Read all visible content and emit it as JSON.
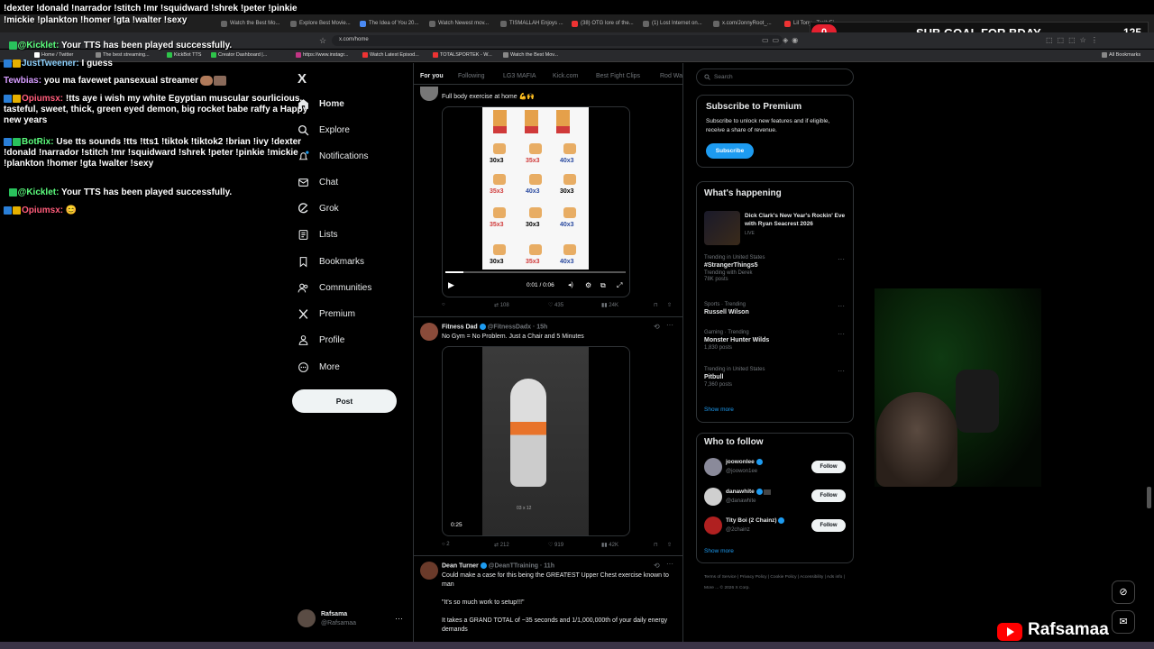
{
  "overlay": {
    "sub_goal_count": "0",
    "sub_goal_label": "SUB GOAL FOR BDAY",
    "sub_goal_target": "125",
    "channel": "Rafsamaa"
  },
  "browser": {
    "tabs": [
      "Home / Twitter",
      "Watch the Best Mo...",
      "Explore Best Movie...",
      "The Idea of You 20...",
      "Watch Newest mov...",
      "TISMALLAH Enjoys ...",
      "(38) OTG lore of the...",
      "(1) Lost Internet on...",
      "x.com/JonnyRoot_...",
      "Lil Tony - TrellyFi..."
    ],
    "url": "x.com/home",
    "bookmarks": [
      "Home / Twitter",
      "The best streaming...",
      "KickBot TTS",
      "Creator Dashboard |...",
      "https://www.instagr...",
      "Watch Latest Episod...",
      "TOTALSPORTEK - W...",
      "Watch the Best Mov..."
    ],
    "all_bookmarks": "All Bookmarks"
  },
  "chat": {
    "line0": "!dexter !donald !narrador !stitch !mr !squidward !shrek !peter !pinkie",
    "line0b": "!mickie !plankton !homer !gta !walter !sexy",
    "m1_user": "@Kicklet:",
    "m1_text": " Your TTS has been played successfully.",
    "m2_user": "JustTweener:",
    "m2_text": " I guess",
    "m3_user": "Tewbias:",
    "m3_text": " you ma favewet pansexual streamer",
    "m4_user": "Opiumsx:",
    "m4_text": " !tts aye i wish my white Egyptian muscular sourlicious, tasteful, sweet, thick, green eyed demon, big rocket babe raffy a Happy new years",
    "m5_user": "BotRix:",
    "m5_text": " Use tts sounds !tts !tts1 !tiktok !tiktok2 !brian !ivy !dexter !donald !narrador !stitch !mr !squidward !shrek !peter !pinkie !mickie !plankton !homer !gta !walter !sexy",
    "m6_user": "@Kicklet:",
    "m6_text": " Your TTS has been played successfully.",
    "m7_user": "Opiumsx:",
    "m7_text": " 😊"
  },
  "sidebar": {
    "logo": "X",
    "items": [
      {
        "label": "Home",
        "icon": "home-icon"
      },
      {
        "label": "Explore",
        "icon": "search-icon"
      },
      {
        "label": "Notifications",
        "icon": "bell-icon"
      },
      {
        "label": "Chat",
        "icon": "mail-icon"
      },
      {
        "label": "Grok",
        "icon": "grok-icon"
      },
      {
        "label": "Lists",
        "icon": "list-icon"
      },
      {
        "label": "Bookmarks",
        "icon": "bookmark-icon"
      },
      {
        "label": "Communities",
        "icon": "people-icon"
      },
      {
        "label": "Premium",
        "icon": "x-icon"
      },
      {
        "label": "Profile",
        "icon": "user-icon"
      },
      {
        "label": "More",
        "icon": "more-icon"
      }
    ],
    "post": "Post",
    "account_name": "Rafsama",
    "account_handle": "@Rafsamaa"
  },
  "feed": {
    "tabs": [
      "For you",
      "Following",
      "LG3 MAFIA",
      "Kick.com",
      "Best Fight Clips",
      "Rod Wa"
    ],
    "tweet1": {
      "text": "Full body exercise at home 💪🙌",
      "video_time": "0:01 / 0:06",
      "grid": [
        "30x3",
        "35x3",
        "40x3",
        "35x3",
        "40x3",
        "30x3",
        "35x3",
        "30x3",
        "40x3",
        "30x3",
        "35x3",
        "40x3"
      ],
      "replies": "",
      "retweets": "108",
      "likes": "435",
      "views": "24K"
    },
    "tweet2": {
      "name": "Fitness Dad",
      "handle": "@FitnessDadx · 15h",
      "text": "No Gym = No Problem. Just a Chair and 5 Minutes",
      "duration": "0:25",
      "video_caption": "03 x 12",
      "replies": "2",
      "retweets": "212",
      "likes": "919",
      "views": "42K"
    },
    "tweet3": {
      "name": "Dean Turner",
      "handle": "@DeanTTraining · 11h",
      "text": "Could make a case for this being the GREATEST Upper Chest exercise known to man",
      "text2": "\"It's so much work to setup!!!\"",
      "text3": "It takes a GRAND TOTAL of ~35 seconds and 1/1,000,000th of your daily energy demands"
    }
  },
  "right": {
    "search_placeholder": "Search",
    "premium_title": "Subscribe to Premium",
    "premium_text": "Subscribe to unlock new features and if eligible, receive a share of revenue.",
    "subscribe": "Subscribe",
    "happening_title": "What's happening",
    "event_title": "Dick Clark's New Year's Rockin' Eve with Ryan Seacrest 2026",
    "event_status": "LIVE",
    "trends": [
      {
        "meta": "Trending in United States",
        "name": "#StrangerThings5",
        "extra": "Trending with Derek",
        "posts": "78K posts"
      },
      {
        "meta": "Sports · Trending",
        "name": "Russell Wilson",
        "extra": "",
        "posts": ""
      },
      {
        "meta": "Gaming · Trending",
        "name": "Monster Hunter Wilds",
        "extra": "",
        "posts": "1,830 posts"
      },
      {
        "meta": "Trending in United States",
        "name": "Pitbull",
        "extra": "",
        "posts": "7,360 posts"
      }
    ],
    "show_more": "Show more",
    "who_title": "Who to follow",
    "who": [
      {
        "name": "joowonlee",
        "handle": "@joowon1ee"
      },
      {
        "name": "danawhite",
        "handle": "@danawhite"
      },
      {
        "name": "Tity Boi (2 Chainz)",
        "handle": "@2chainz"
      }
    ],
    "follow": "Follow",
    "footer": [
      "Terms of Service",
      "Privacy Policy",
      "Cookie Policy",
      "Accessibility",
      "Ads info",
      "More ...",
      "© 2026 X Corp."
    ]
  }
}
